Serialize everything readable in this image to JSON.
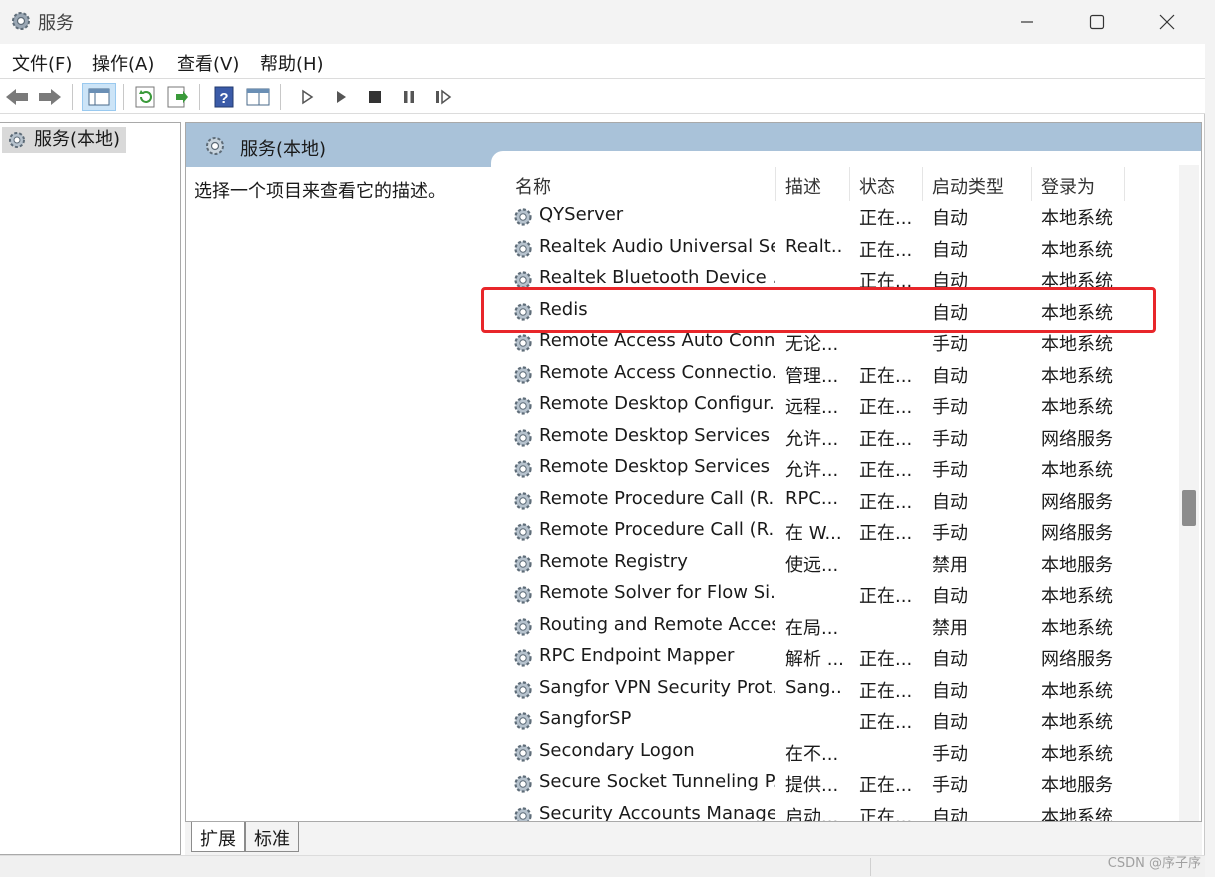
{
  "window": {
    "title": "服务"
  },
  "menu": [
    {
      "label": "文件(F)"
    },
    {
      "label": "操作(A)"
    },
    {
      "label": "查看(V)"
    },
    {
      "label": "帮助(H)"
    }
  ],
  "tree": {
    "root_label": "服务(本地)"
  },
  "pane": {
    "header": "服务(本地)",
    "description_prompt": "选择一个项目来查看它的描述。"
  },
  "columns": [
    {
      "label": "名称"
    },
    {
      "label": "描述"
    },
    {
      "label": "状态"
    },
    {
      "label": "启动类型"
    },
    {
      "label": "登录为"
    }
  ],
  "services": [
    {
      "name": "QYServer",
      "desc": "",
      "status": "正在...",
      "startup": "自动",
      "logon": "本地系统"
    },
    {
      "name": "Realtek Audio Universal Se...",
      "desc": "Realt...",
      "status": "正在...",
      "startup": "自动",
      "logon": "本地系统"
    },
    {
      "name": "Realtek Bluetooth Device ...",
      "desc": "",
      "status": "正在...",
      "startup": "自动",
      "logon": "本地系统"
    },
    {
      "name": "Redis",
      "desc": "",
      "status": "",
      "startup": "自动",
      "logon": "本地系统"
    },
    {
      "name": "Remote Access Auto Conn...",
      "desc": "无论...",
      "status": "",
      "startup": "手动",
      "logon": "本地系统"
    },
    {
      "name": "Remote Access Connectio...",
      "desc": "管理...",
      "status": "正在...",
      "startup": "自动",
      "logon": "本地系统"
    },
    {
      "name": "Remote Desktop Configur...",
      "desc": "远程...",
      "status": "正在...",
      "startup": "手动",
      "logon": "本地系统"
    },
    {
      "name": "Remote Desktop Services",
      "desc": "允许...",
      "status": "正在...",
      "startup": "手动",
      "logon": "网络服务"
    },
    {
      "name": "Remote Desktop Services ...",
      "desc": "允许...",
      "status": "正在...",
      "startup": "手动",
      "logon": "本地系统"
    },
    {
      "name": "Remote Procedure Call (R...",
      "desc": "RPC...",
      "status": "正在...",
      "startup": "自动",
      "logon": "网络服务"
    },
    {
      "name": "Remote Procedure Call (R...",
      "desc": "在 W...",
      "status": "正在...",
      "startup": "手动",
      "logon": "网络服务"
    },
    {
      "name": "Remote Registry",
      "desc": "使远...",
      "status": "",
      "startup": "禁用",
      "logon": "本地服务"
    },
    {
      "name": "Remote Solver for Flow Si...",
      "desc": "",
      "status": "正在...",
      "startup": "自动",
      "logon": "本地系统"
    },
    {
      "name": "Routing and Remote Access",
      "desc": "在局...",
      "status": "",
      "startup": "禁用",
      "logon": "本地系统"
    },
    {
      "name": "RPC Endpoint Mapper",
      "desc": "解析 ...",
      "status": "正在...",
      "startup": "自动",
      "logon": "网络服务"
    },
    {
      "name": "Sangfor VPN Security Prot...",
      "desc": "Sang...",
      "status": "正在...",
      "startup": "自动",
      "logon": "本地系统"
    },
    {
      "name": "SangforSP",
      "desc": "",
      "status": "正在...",
      "startup": "自动",
      "logon": "本地系统"
    },
    {
      "name": "Secondary Logon",
      "desc": "在不...",
      "status": "",
      "startup": "手动",
      "logon": "本地系统"
    },
    {
      "name": "Secure Socket Tunneling P...",
      "desc": "提供...",
      "status": "正在...",
      "startup": "手动",
      "logon": "本地服务"
    },
    {
      "name": "Security Accounts Manager",
      "desc": "启动...",
      "status": "正在...",
      "startup": "自动",
      "logon": "本地系统"
    }
  ],
  "tabs": [
    {
      "label": "扩展"
    },
    {
      "label": "标准"
    }
  ],
  "watermark": "CSDN @序子序",
  "colors": {
    "highlight": "#e8262a",
    "pane_header": "#a9c2d9"
  }
}
